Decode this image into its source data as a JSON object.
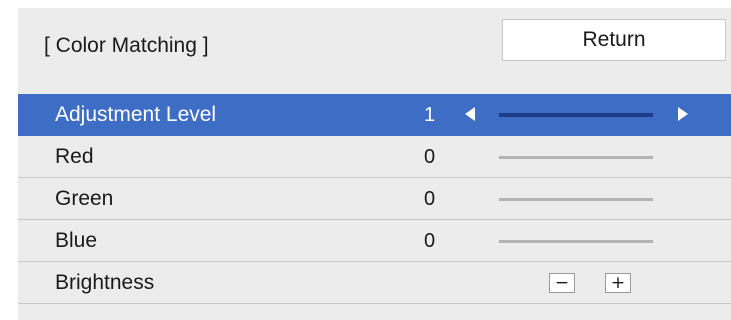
{
  "header": {
    "title": "[ Color Matching ]",
    "return_label": "Return"
  },
  "rows": [
    {
      "label": "Adjustment Level",
      "value": "1",
      "selected": true
    },
    {
      "label": "Red",
      "value": "0"
    },
    {
      "label": "Green",
      "value": "0"
    },
    {
      "label": "Blue",
      "value": "0"
    },
    {
      "label": "Brightness"
    }
  ],
  "brightness_controls": {
    "minus_label": "−",
    "plus_label": "+"
  },
  "colors": {
    "selected_row": "#3e6dc5",
    "panel_background": "#ececec",
    "selected_slider": "#1f3d86",
    "slider": "#b4b4b4"
  },
  "icons": {
    "decrease": "triangle-left-icon",
    "increase": "triangle-right-icon"
  }
}
